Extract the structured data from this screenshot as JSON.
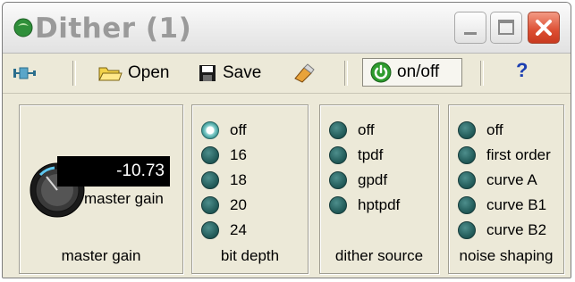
{
  "window": {
    "title": "Dither (1)"
  },
  "toolbar": {
    "open_label": "Open",
    "save_label": "Save",
    "onoff_label": "on/off",
    "help_label": "?"
  },
  "master_gain": {
    "value": "-10.73",
    "knob_caption": "master gain",
    "group_label": "master gain"
  },
  "bit_depth": {
    "label": "bit depth",
    "options": [
      "off",
      "16",
      "18",
      "20",
      "24"
    ],
    "selected": "off"
  },
  "dither_source": {
    "label": "dither source",
    "options": [
      "off",
      "tpdf",
      "gpdf",
      "hptpdf"
    ]
  },
  "noise_shaping": {
    "label": "noise shaping",
    "options": [
      "off",
      "first order",
      "curve A",
      "curve B1",
      "curve B2"
    ]
  },
  "colors": {
    "radio_fill": "#1f5755",
    "power_icon": "#2e9c2e",
    "close_button": "#dc4e32",
    "window_face": "#ece9d8"
  }
}
